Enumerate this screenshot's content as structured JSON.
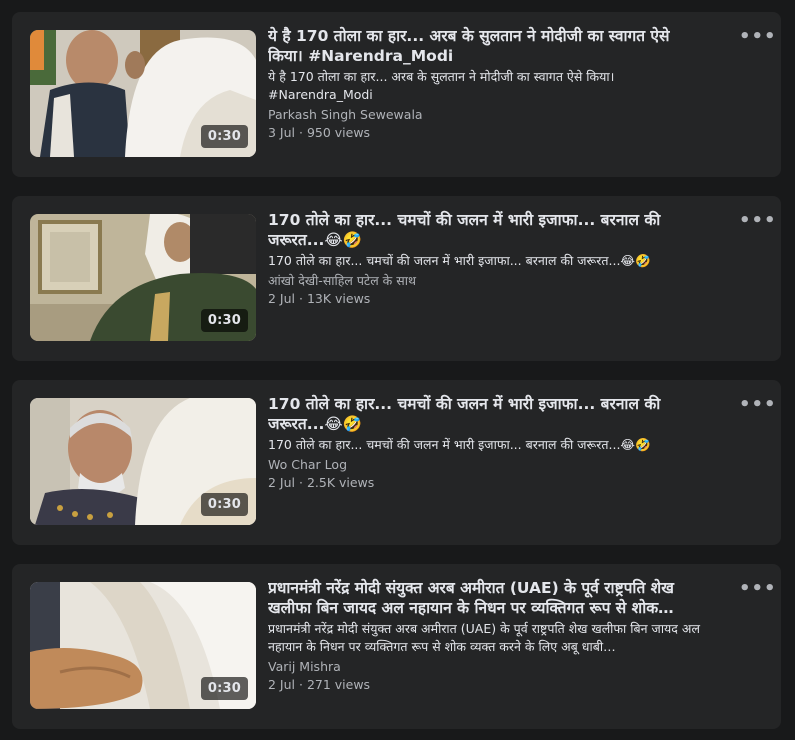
{
  "more_icon_glyph": "•••",
  "videos": [
    {
      "title": "ये है 170 तोला का हार... अरब के सुलतान ने मोदीजी का स्वागत ऐसे किया। #Narendra_Modi",
      "description": "ये है 170 तोला का हार... अरब के सुलतान ने मोदीजी का स्वागत ऐसे किया। #Narendra_Modi",
      "author": "Parkash Singh Sewewala",
      "date": "3 Jul",
      "views": "950 views",
      "duration": "0:30"
    },
    {
      "title": "170 तोले का हार... चमचों की जलन में भारी इजाफा... बरनाल की जरूरत...😂🤣",
      "description": "170 तोले का हार... चमचों की जलन में भारी इजाफा... बरनाल की जरूरत...😂🤣",
      "author": "आंखो देखी-साहिल पटेल के साथ",
      "date": "2 Jul",
      "views": "13K views",
      "duration": "0:30"
    },
    {
      "title": "170 तोले का हार... चमचों की जलन में भारी इजाफा... बरनाल की जरूरत...😂🤣",
      "description": "170 तोले का हार... चमचों की जलन में भारी इजाफा... बरनाल की जरूरत...😂🤣",
      "author": "Wo Char Log",
      "date": "2 Jul",
      "views": "2.5K views",
      "duration": "0:30"
    },
    {
      "title": "प्रधानमंत्री नरेंद्र मोदी संयुक्त अरब अमीरात (UAE) के पूर्व राष्ट्रपति शेख खलीफा बिन जायद अल नहायान के निधन पर व्यक्तिगत रूप से शोक…",
      "description": "प्रधानमंत्री नरेंद्र मोदी संयुक्त अरब अमीरात (UAE) के पूर्व राष्ट्रपति शेख खलीफा बिन जायद अल नहायान के निधन पर व्यक्तिगत रूप से शोक व्यक्त करने के लिए अबू धाबी…",
      "author": "Varij Mishra",
      "date": "2 Jul",
      "views": "271 views",
      "duration": "0:30"
    }
  ]
}
